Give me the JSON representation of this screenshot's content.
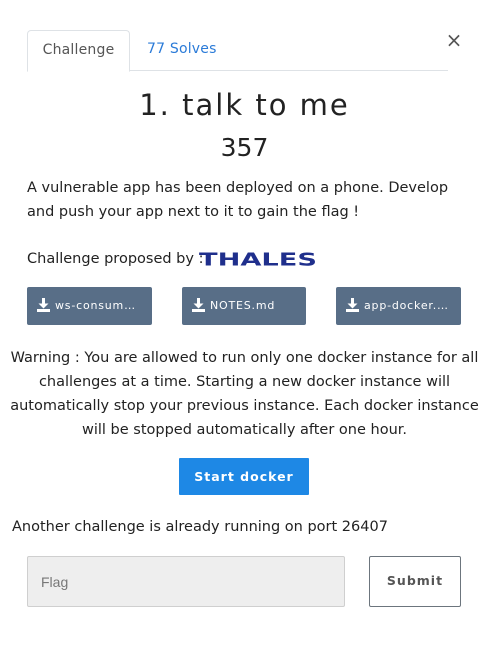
{
  "dialog": {
    "close_glyph": "×"
  },
  "tabs": [
    {
      "label": "Challenge"
    },
    {
      "label": "77 Solves"
    }
  ],
  "challenge": {
    "title": "1. talk to me",
    "points": "357",
    "description": "A vulnerable app has been deployed on a phone. Develop and push your app next to it to gain the flag !",
    "proposed_label": "Challenge proposed by :",
    "proposer_logo_text": "THALES"
  },
  "files": [
    {
      "name": "ws-consumer-app.zip"
    },
    {
      "name": "NOTES.md"
    },
    {
      "name": "app-docker.apk"
    }
  ],
  "warning": "Warning : You are allowed to run only one docker instance for all challenges at a time. Starting a new docker instance will automatically stop your previous instance. Each docker instance will be stopped automatically after one hour.",
  "docker": {
    "start_label": "Start docker",
    "status": "Another challenge is already running on port 26407"
  },
  "flag_form": {
    "placeholder": "Flag",
    "value": "",
    "submit_label": "Submit"
  },
  "colors": {
    "accent": "#1e88e5",
    "file_button": "#586e87",
    "link": "#2b7bd8",
    "thales_blue": "#1f2f8c"
  },
  "icons": {
    "close": "close-icon",
    "download": "download-icon"
  }
}
